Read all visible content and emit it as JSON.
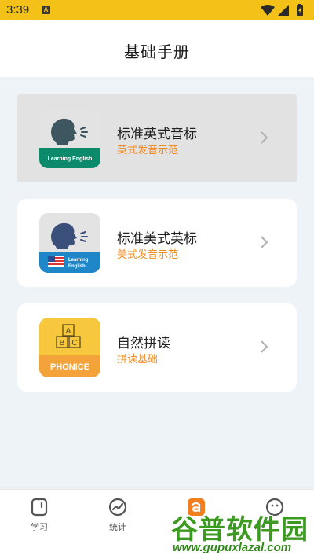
{
  "status_bar": {
    "time": "3:39",
    "notification_letter": "A",
    "icons": [
      "wifi-icon",
      "signal-icon",
      "battery-icon"
    ]
  },
  "header": {
    "title": "基础手册"
  },
  "cards": [
    {
      "title": "标准英式音标",
      "subtitle": "英式发音示范",
      "badge_text": "Learning English",
      "badge_color": "#0d8a6c",
      "selected": true
    },
    {
      "title": "标准美式英标",
      "subtitle": "美式发音示范",
      "badge_text_line1": "Learning",
      "badge_text_line2": "English",
      "badge_color": "#1f86c8"
    },
    {
      "title": "自然拼读",
      "subtitle": "拼读基础",
      "badge_text": "PHONICE",
      "badge_color": "#f4a23a",
      "blocks": [
        "A",
        "B",
        "C"
      ]
    }
  ],
  "tabs": [
    {
      "label": "学习",
      "icon": "book-icon"
    },
    {
      "label": "统计",
      "icon": "chart-icon"
    },
    {
      "label": "",
      "icon": "app-logo-icon",
      "active": true
    },
    {
      "label": "",
      "icon": "smiley-icon"
    }
  ],
  "watermark": {
    "cn": "谷普软件园",
    "en": "www.gupuxlazal.com"
  },
  "colors": {
    "accent": "#f3c118",
    "subtitle": "#f2891c",
    "page_bg": "#eef3f8"
  }
}
